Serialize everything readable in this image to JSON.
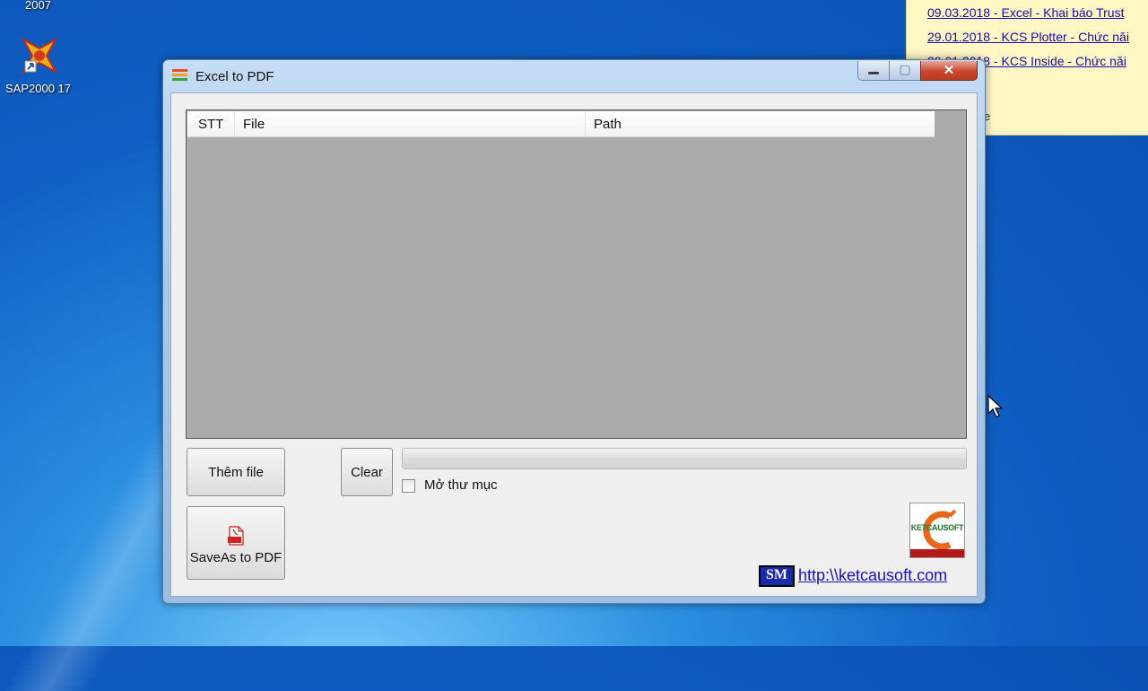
{
  "desktop": {
    "top_label": "2007",
    "sap_label": "SAP2000 17"
  },
  "notifications": {
    "items": [
      "09.03.2018 - Excel - Khai báo Trust",
      "29.01.2018 - KCS Plotter - Chức năi",
      "29.01.2018 - KCS Inside - Chức năi"
    ],
    "extra": "e"
  },
  "window": {
    "title": "Excel to PDF",
    "list": {
      "columns": [
        "STT",
        "File",
        "Path"
      ]
    },
    "buttons": {
      "add_file": "Thêm file",
      "clear": "Clear",
      "save_as_pdf": "SaveAs to PDF"
    },
    "progress": 0,
    "open_folder": {
      "label": "Mở thư mục",
      "checked": false
    },
    "logo": {
      "text": "KETCAUSOFT"
    },
    "badge": "SM",
    "link": "http:\\\\ketcausoft.com"
  },
  "colors": {
    "link": "#1a0dcc",
    "list_bg": "#ababab",
    "close_red": "#c9462c"
  }
}
